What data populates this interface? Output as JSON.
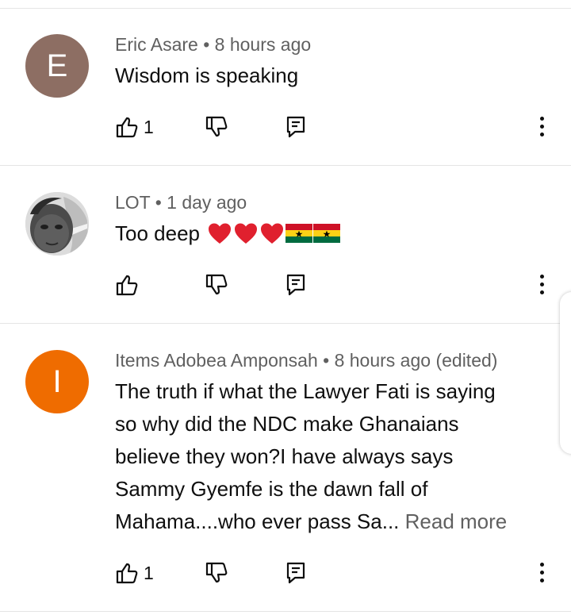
{
  "comments": [
    {
      "avatar_letter": "E",
      "avatar_color": "#8d6e63",
      "author": "Eric Asare",
      "time": "8 hours ago",
      "text": "Wisdom is speaking",
      "likes": "1"
    },
    {
      "avatar_color": "#cfcfcf",
      "author": "LOT",
      "time": "1 day ago",
      "text": "Too deep",
      "emojis": [
        "red-heart",
        "red-heart",
        "red-heart",
        "ghana-flag",
        "ghana-flag"
      ],
      "likes": ""
    },
    {
      "avatar_letter": "I",
      "avatar_color": "#ef6c00",
      "author": "Items Adobea Amponsah",
      "time": "8 hours ago",
      "edited": "(edited)",
      "text_lines": [
        "The truth if what the Lawyer  Fati is saying",
        "so why did the NDC  make Ghanaians",
        "believe they won?I have always says",
        "Sammy Gyemfe is the dawn fall  of",
        "Mahama....who ever pass Sa..."
      ],
      "read_more": "Read more",
      "likes": "1"
    }
  ],
  "separator": " • ",
  "icons": {
    "like": "thumbs-up-icon",
    "dislike": "thumbs-down-icon",
    "reply": "reply-icon",
    "more": "more-vertical-icon"
  }
}
